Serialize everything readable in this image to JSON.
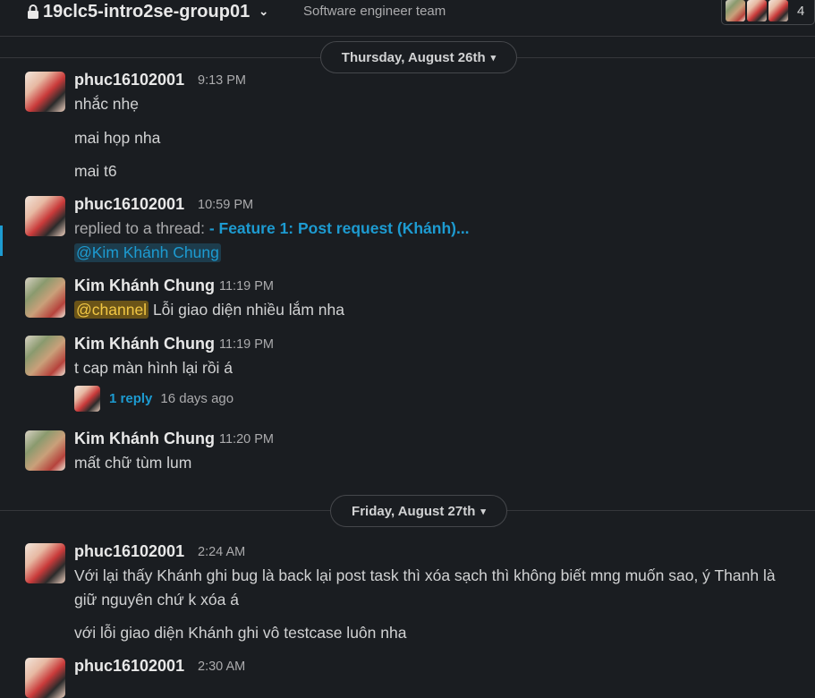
{
  "header": {
    "channel_name": "19clc5-intro2se-group01",
    "topic": "Software engineer team",
    "member_count": "4"
  },
  "dates": {
    "first": "Thursday, August 26th",
    "second": "Friday, August 27th"
  },
  "messages": [
    {
      "author": "phuc16102001",
      "time": "9:13 PM",
      "lines": [
        "nhắc nhẹ",
        "mai họp nha",
        "mai t6"
      ]
    },
    {
      "author": "phuc16102001",
      "time": "10:59 PM",
      "replied_prefix": "replied to a thread:",
      "thread_title": "- Feature 1: Post request (Khánh)...",
      "mention": "@Kim Khánh Chung"
    },
    {
      "author": "Kim Khánh Chung",
      "time": "11:19 PM",
      "channel_mention": "@channel",
      "text": "Lỗi giao diện nhiều lắm nha"
    },
    {
      "author": "Kim Khánh Chung",
      "time": "11:19 PM",
      "text": "t cap màn hình lại rồi á",
      "reply_count": "1 reply",
      "reply_time": "16 days ago"
    },
    {
      "author": "Kim Khánh Chung",
      "time": "11:20 PM",
      "text": "mất chữ tùm lum"
    },
    {
      "author": "phuc16102001",
      "time": "2:24 AM",
      "lines": [
        "Với lại thấy Khánh ghi bug là back lại post task thì xóa sạch thì không biết mng muốn sao, ý Thanh là",
        "giữ nguyên chứ k xóa á",
        "với lỗi giao diện Khánh ghi vô testcase luôn nha"
      ]
    },
    {
      "author": "phuc16102001",
      "time": "2:30 AM"
    }
  ]
}
